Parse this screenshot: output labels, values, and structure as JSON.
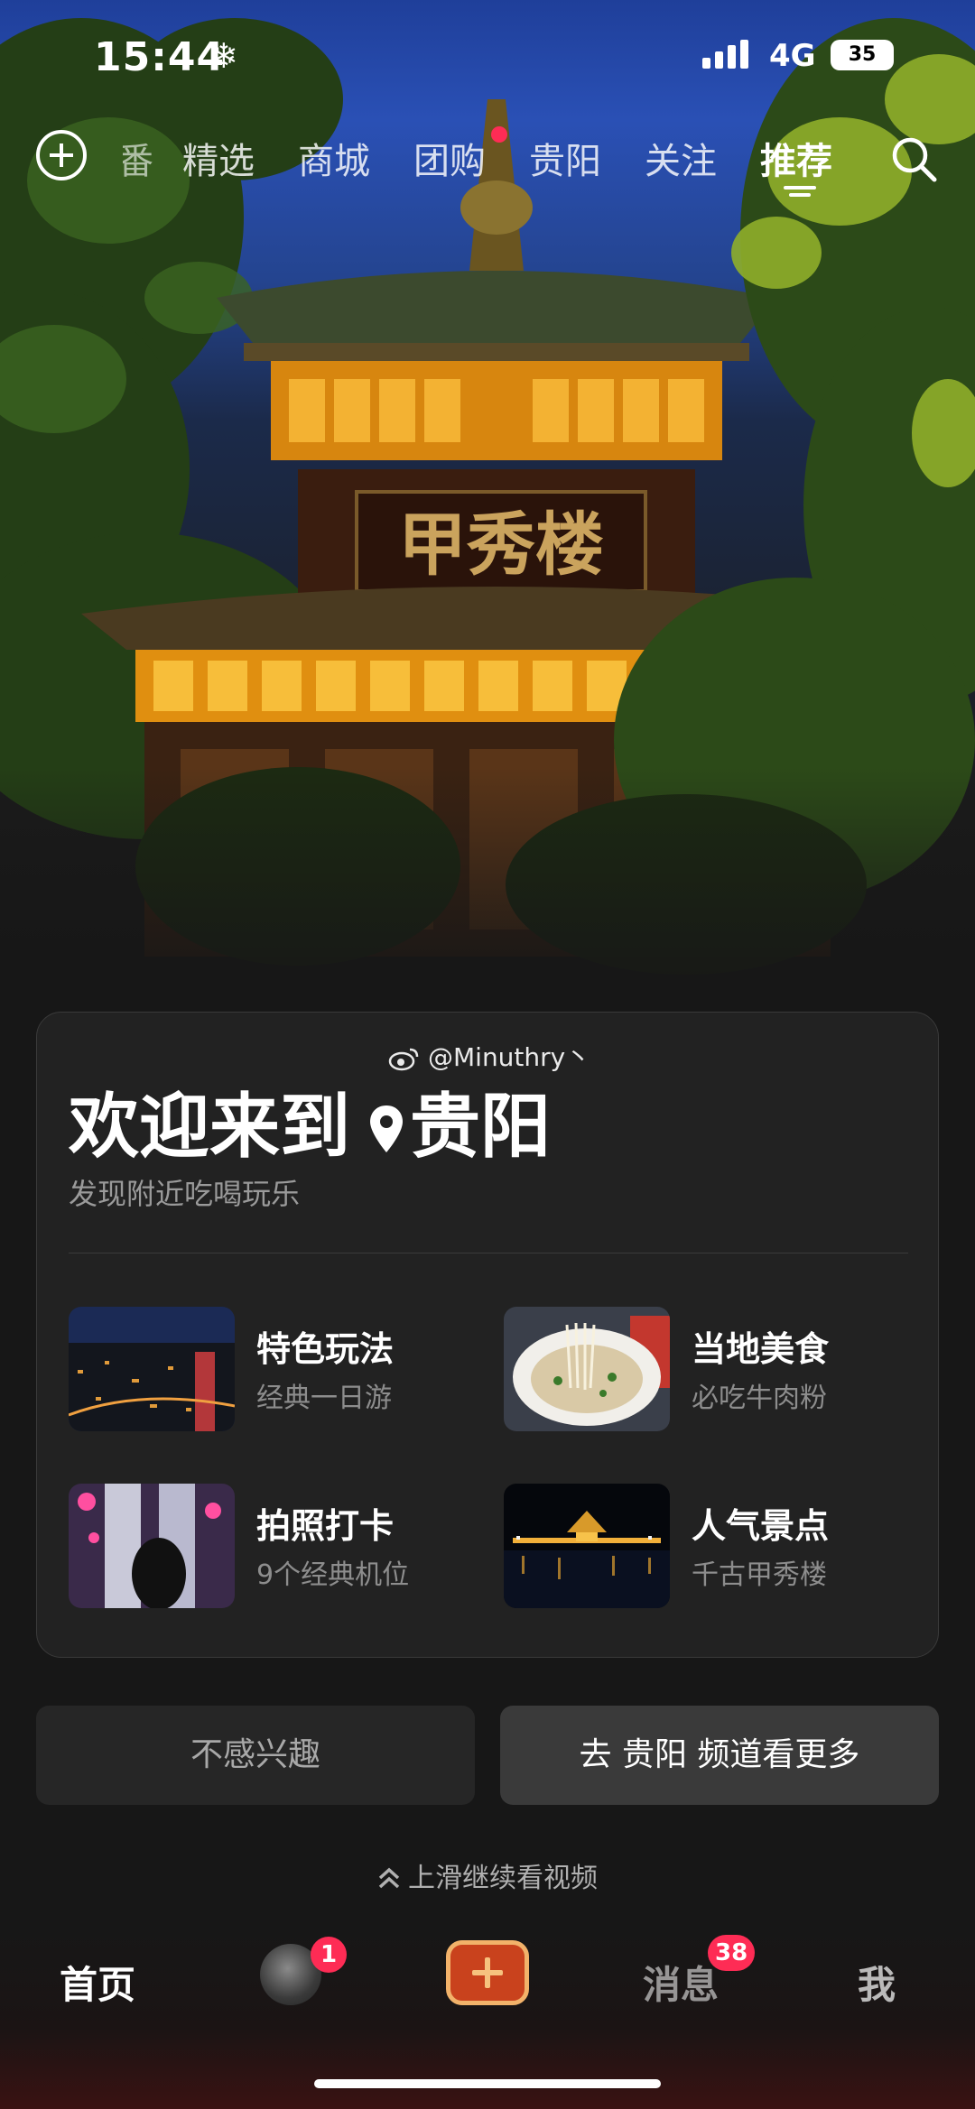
{
  "status_bar": {
    "time": "15:44",
    "network": "4G",
    "battery": "35"
  },
  "top_nav": {
    "tabs": [
      {
        "label": "番",
        "state": "partial"
      },
      {
        "label": "精选",
        "state": "normal"
      },
      {
        "label": "商城",
        "state": "normal"
      },
      {
        "label": "团购",
        "state": "normal",
        "has_dot": true
      },
      {
        "label": "贵阳",
        "state": "normal"
      },
      {
        "label": "关注",
        "state": "normal"
      },
      {
        "label": "推荐",
        "state": "active"
      }
    ]
  },
  "hero": {
    "sign_text": "甲秀楼"
  },
  "card": {
    "watermark": "@Minuthry丶",
    "welcome_prefix": "欢迎来到",
    "city": "贵阳",
    "subtitle": "发现附近吃喝玩乐",
    "items": [
      {
        "title": "特色玩法",
        "subtitle": "经典一日游"
      },
      {
        "title": "当地美食",
        "subtitle": "必吃牛肉粉"
      },
      {
        "title": "拍照打卡",
        "subtitle": "9个经典机位"
      },
      {
        "title": "人气景点",
        "subtitle": "千古甲秀楼"
      }
    ]
  },
  "actions": {
    "not_interested": "不感兴趣",
    "more": "去 贵阳 频道看更多"
  },
  "swipe_hint": "上滑继续看视频",
  "bottom_nav": {
    "home": "首页",
    "friend_badge": "1",
    "messages": "消息",
    "messages_badge": "38",
    "me": "我"
  },
  "colors": {
    "accent_red": "#fe2c55",
    "card_bg": "#222222",
    "page_bg": "#171717"
  }
}
